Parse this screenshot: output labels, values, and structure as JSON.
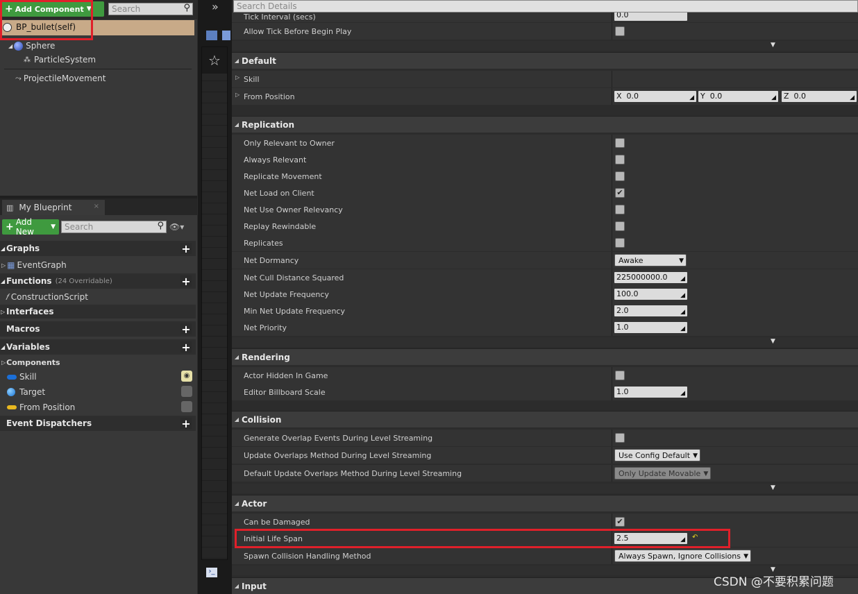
{
  "components_panel": {
    "add_component_label": "Add Component",
    "search_placeholder": "Search",
    "items": [
      {
        "label": "BP_bullet(self)"
      },
      {
        "label": "Sphere"
      },
      {
        "label": "ParticleSystem"
      },
      {
        "label": "ProjectileMovement"
      }
    ]
  },
  "my_blueprint": {
    "tab_label": "My Blueprint",
    "add_new_label": "Add New",
    "search_placeholder": "Search",
    "graphs_label": "Graphs",
    "event_graph_label": "EventGraph",
    "functions_label": "Functions",
    "functions_count": "(24 Overridable)",
    "construction_script_label": "ConstructionScript",
    "interfaces_label": "Interfaces",
    "macros_label": "Macros",
    "variables_label": "Variables",
    "components_label": "Components",
    "variables": [
      {
        "label": "Skill"
      },
      {
        "label": "Target"
      },
      {
        "label": "From Position"
      }
    ],
    "event_dispatchers_label": "Event Dispatchers"
  },
  "details": {
    "search_placeholder": "Search Details",
    "partial_top_label": "Tick Interval (secs)",
    "partial_top_value": "0.0",
    "allow_tick_label": "Allow Tick Before Begin Play",
    "default": {
      "title": "Default",
      "skill_label": "Skill",
      "from_position_label": "From Position",
      "x_label": "X",
      "x_value": "0.0",
      "y_label": "Y",
      "y_value": "0.0",
      "z_label": "Z",
      "z_value": "0.0"
    },
    "replication": {
      "title": "Replication",
      "only_relevant_to_owner": "Only Relevant to Owner",
      "always_relevant": "Always Relevant",
      "replicate_movement": "Replicate Movement",
      "net_load_on_client": "Net Load on Client",
      "net_use_owner_relevancy": "Net Use Owner Relevancy",
      "replay_rewindable": "Replay Rewindable",
      "replicates": "Replicates",
      "net_dormancy_label": "Net Dormancy",
      "net_dormancy_value": "Awake",
      "net_cull_label": "Net Cull Distance Squared",
      "net_cull_value": "225000000.0",
      "net_update_freq_label": "Net Update Frequency",
      "net_update_freq_value": "100.0",
      "min_net_update_label": "Min Net Update Frequency",
      "min_net_update_value": "2.0",
      "net_priority_label": "Net Priority",
      "net_priority_value": "1.0"
    },
    "rendering": {
      "title": "Rendering",
      "actor_hidden_label": "Actor Hidden In Game",
      "billboard_label": "Editor Billboard Scale",
      "billboard_value": "1.0"
    },
    "collision": {
      "title": "Collision",
      "gen_overlap_label": "Generate Overlap Events During Level Streaming",
      "update_overlaps_label": "Update Overlaps Method During Level Streaming",
      "update_overlaps_value": "Use Config Default",
      "default_update_label": "Default Update Overlaps Method During Level Streaming",
      "default_update_value": "Only Update Movable"
    },
    "actor": {
      "title": "Actor",
      "can_be_damaged_label": "Can be Damaged",
      "initial_life_span_label": "Initial Life Span",
      "initial_life_span_value": "2.5",
      "spawn_collision_label": "Spawn Collision Handling Method",
      "spawn_collision_value": "Always Spawn, Ignore Collisions"
    },
    "input": {
      "title": "Input"
    }
  },
  "watermark": "CSDN @不要积累问题",
  "colors": {
    "accent_green": "#3f9a3f",
    "highlight_red": "#e0202a",
    "selected_row": "#c8aa88"
  }
}
